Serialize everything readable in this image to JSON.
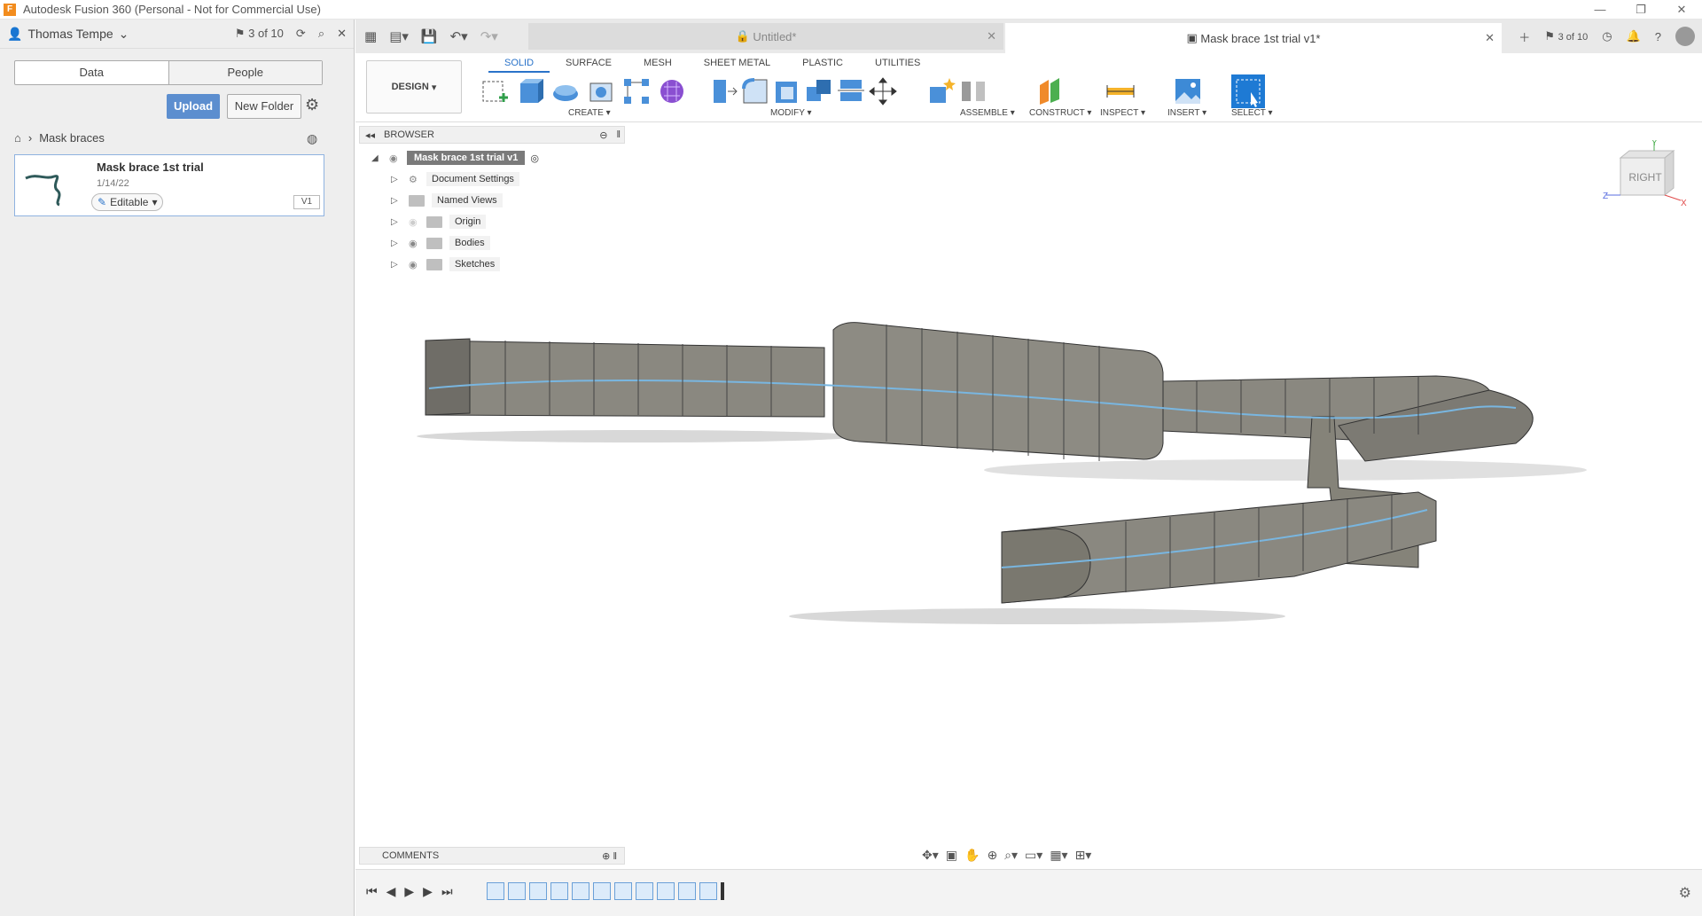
{
  "app": {
    "title": "Autodesk Fusion 360 (Personal - Not for Commercial Use)",
    "logo_letter": "F"
  },
  "window_controls": {
    "minimize": "—",
    "restore": "❐",
    "close": "✕"
  },
  "left_panel": {
    "user": "Thomas Tempe",
    "count": "3 of 10",
    "tabs": [
      "Data",
      "People"
    ],
    "upload": "Upload",
    "new_folder": "New Folder",
    "breadcrumb": "Mask braces",
    "file": {
      "name": "Mask brace 1st trial",
      "date": "1/14/22",
      "status": "Editable",
      "version": "V1"
    }
  },
  "doc_tabs": {
    "untitled": "Untitled*",
    "active": "Mask brace 1st trial v1*",
    "count": "3 of 10"
  },
  "workspace": {
    "mode": "DESIGN",
    "tabs": [
      "SOLID",
      "SURFACE",
      "MESH",
      "SHEET METAL",
      "PLASTIC",
      "UTILITIES"
    ],
    "active_tab": "SOLID",
    "groups": [
      "CREATE",
      "MODIFY",
      "ASSEMBLE",
      "CONSTRUCT",
      "INSPECT",
      "INSERT",
      "SELECT"
    ]
  },
  "browser": {
    "title": "BROWSER",
    "root": "Mask brace 1st trial v1",
    "items": [
      "Document Settings",
      "Named Views",
      "Origin",
      "Bodies",
      "Sketches"
    ]
  },
  "comments": {
    "title": "COMMENTS"
  },
  "viewcube": {
    "face": "RIGHT",
    "axis_y": "Y",
    "axis_z": "Z",
    "axis_x": "X"
  },
  "colors": {
    "accent": "#2a73c9",
    "upload": "#5c8ecf",
    "body": "#8a8880",
    "sketch": "#79b6e0"
  }
}
